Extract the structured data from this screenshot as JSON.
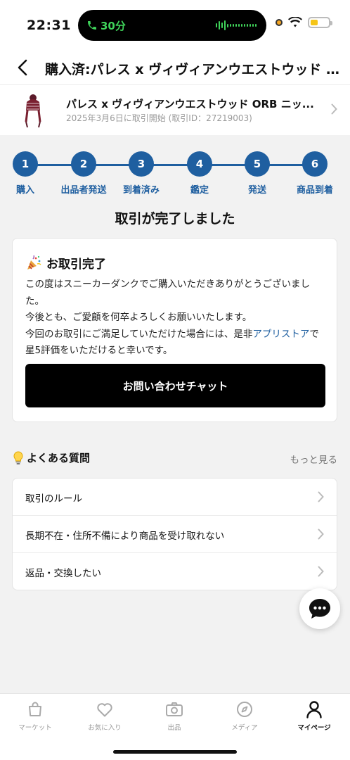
{
  "status_bar": {
    "time": "22:31",
    "call_label": "30分",
    "battery_level": 0.4
  },
  "nav": {
    "title": "購入済:パレス x ヴィヴィアンウエストウッド O..."
  },
  "product": {
    "name": "パレス x ヴィヴィアンウエストウッド ORB ニッ...",
    "subtitle": "2025年3月6日に取引開始 (取引ID：27219003)"
  },
  "steps": [
    {
      "number": "1",
      "label": "購入"
    },
    {
      "number": "2",
      "label": "出品者発送"
    },
    {
      "number": "3",
      "label": "到着済み"
    },
    {
      "number": "4",
      "label": "鑑定"
    },
    {
      "number": "5",
      "label": "発送"
    },
    {
      "number": "6",
      "label": "商品到着"
    }
  ],
  "completed_title": "取引が完了しました",
  "done_card": {
    "heading": "お取引完了",
    "line1": "この度はスニーカーダンクでご購入いただきありがとうございました。",
    "line2": "今後とも、ご愛顧を何卒よろしくお願いいたします。",
    "line3_pre": "今回のお取引にご満足していただけた場合には、是非",
    "line3_link": "アプリストア",
    "line3_post": "で星5評価をいただけると幸いです。",
    "chat_button": "お問い合わせチャット"
  },
  "faq": {
    "title": "よくある質問",
    "more": "もっと見る",
    "items": [
      {
        "label": "取引のルール"
      },
      {
        "label": "長期不在・住所不備により商品を受け取れない"
      },
      {
        "label": "返品・交換したい"
      }
    ]
  },
  "tabs": [
    {
      "label": "マーケット",
      "icon": "bag-icon"
    },
    {
      "label": "お気に入り",
      "icon": "heart-icon"
    },
    {
      "label": "出品",
      "icon": "camera-icon"
    },
    {
      "label": "メディア",
      "icon": "compass-icon"
    },
    {
      "label": "マイページ",
      "icon": "person-icon",
      "active": true
    }
  ],
  "colors": {
    "accent": "#1f5fa0",
    "call_green": "#3fd35a"
  }
}
